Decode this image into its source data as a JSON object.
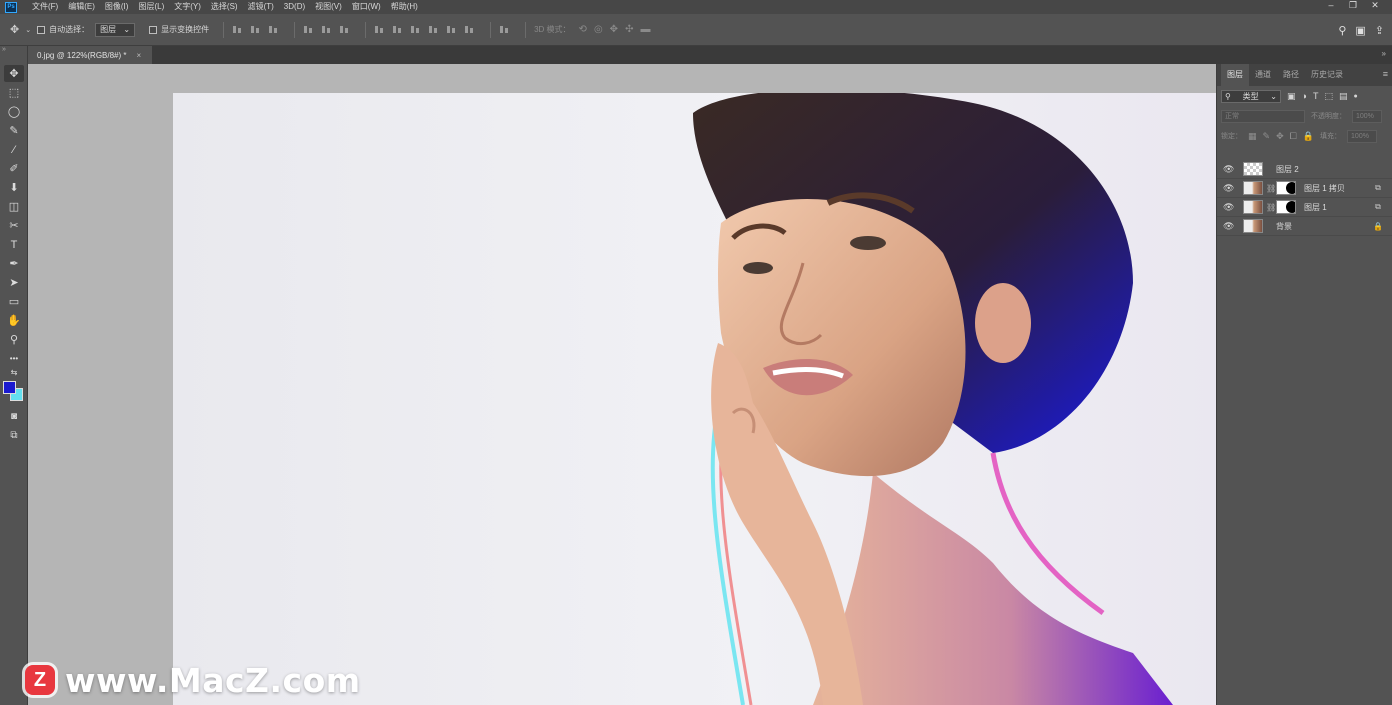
{
  "app": {
    "logo": "Ps"
  },
  "menu": [
    "文件(F)",
    "编辑(E)",
    "图像(I)",
    "图层(L)",
    "文字(Y)",
    "选择(S)",
    "滤镜(T)",
    "3D(D)",
    "视图(V)",
    "窗口(W)",
    "帮助(H)"
  ],
  "window_controls": {
    "minimize": "–",
    "restore": "❐",
    "close": "✕"
  },
  "options": {
    "move_icon": "✥",
    "auto_select_label": "自动选择：",
    "auto_select_value": "图层",
    "transform_label": "显示变换控件",
    "mode_label": "3D 模式："
  },
  "document": {
    "tab_title": "0.jpg @ 122%(RGB/8#) *",
    "close": "×"
  },
  "toolbar": {
    "tools": [
      "✥",
      "⬚",
      "◯",
      "✎",
      "⁄",
      "✐",
      "⬇",
      "◫",
      "✂",
      "T",
      "✒",
      "➤",
      "▭",
      "✋",
      "⚲",
      "•••"
    ],
    "foreground_color": "#1a1ad0",
    "background_color": "#63e0f0"
  },
  "panel": {
    "tabs": [
      "图层",
      "通道",
      "路径",
      "历史记录"
    ],
    "kind_label": "类型",
    "blend_mode": "正常",
    "opacity_label": "不透明度：",
    "opacity_value": "100%",
    "lock_label": "锁定：",
    "fill_label": "填充：",
    "fill_value": "100%",
    "layers": [
      {
        "name": "图层 2",
        "thumb": "checker",
        "mask": false,
        "badge": ""
      },
      {
        "name": "图层 1 拷贝",
        "thumb": "photo",
        "mask": true,
        "badge": "⧉"
      },
      {
        "name": "图层 1",
        "thumb": "photo",
        "mask": true,
        "badge": "⧉"
      },
      {
        "name": "背景",
        "thumb": "photo",
        "mask": false,
        "badge": "🔒"
      }
    ]
  },
  "watermark": {
    "logo": "Z",
    "text": "www.MacZ.com"
  }
}
